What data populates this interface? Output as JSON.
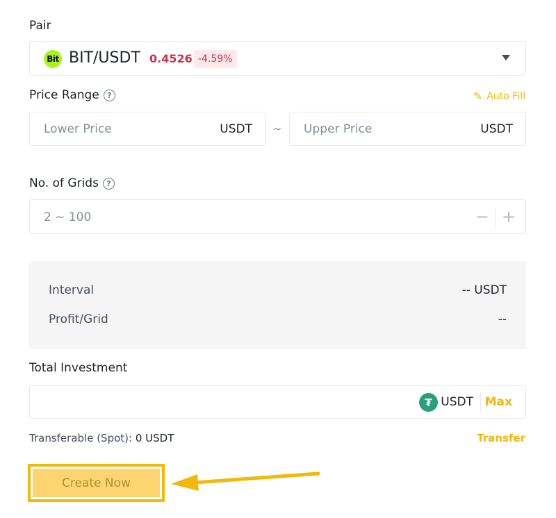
{
  "pair": {
    "label": "Pair",
    "logo_text": "Bit",
    "name": "BIT/USDT",
    "price": "0.4526",
    "change": "-4.59%"
  },
  "price_range": {
    "label": "Price Range",
    "help_glyph": "?",
    "auto_fill": "Auto Fill",
    "lower_placeholder": "Lower Price",
    "upper_placeholder": "Upper Price",
    "unit": "USDT",
    "separator": "~"
  },
  "grids": {
    "label": "No. of Grids",
    "help_glyph": "?",
    "placeholder": "2 ~ 100",
    "minus": "−",
    "plus": "+"
  },
  "summary": {
    "interval_label": "Interval",
    "interval_value": "-- USDT",
    "profit_label": "Profit/Grid",
    "profit_value": "--"
  },
  "investment": {
    "label": "Total Investment",
    "logo_text": "₮",
    "unit": "USDT",
    "max": "Max",
    "transferable_label": "Transferable (Spot):",
    "transferable_value": "0 USDT",
    "transfer": "Transfer"
  },
  "create_button": "Create Now",
  "colors": {
    "accent": "#f0b90b",
    "negative": "#cf304a",
    "usdt": "#26a17b",
    "bit": "#a8f51e"
  },
  "icons": {
    "help": "question-circle-icon",
    "autofill": "pencil-icon",
    "caret": "caret-down-icon",
    "annotation": "arrow-left-icon"
  }
}
